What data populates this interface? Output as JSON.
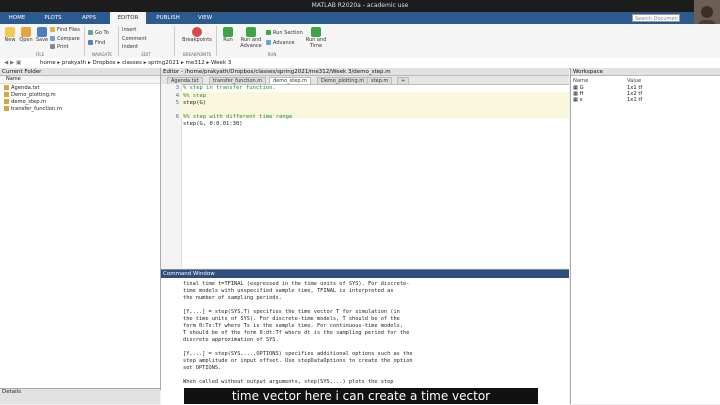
{
  "window_title": "MATLAB R2020a - academic use",
  "ribbon_tabs": [
    "HOME",
    "PLOTS",
    "APPS",
    "EDITOR",
    "PUBLISH",
    "VIEW"
  ],
  "search_placeholder": "Search Documen",
  "toolstrip": {
    "new": "New",
    "open": "Open",
    "save": "Save",
    "find_files": "Find Files",
    "compare": "Compare",
    "print": "Print",
    "go_to": "Go To",
    "find": "Find",
    "insert": "Insert",
    "comment": "Comment",
    "indent": "Indent",
    "breakpoints": "Breakpoints",
    "run": "Run",
    "run_and_advance": "Run and Advance",
    "run_section": "Run Section",
    "advance": "Advance",
    "run_and_time": "Run and Time",
    "groups": [
      "FILE",
      "NAVIGATE",
      "EDIT",
      "BREAKPOINTS",
      "RUN"
    ]
  },
  "address_path": [
    "home",
    "prakyath",
    "Dropbox",
    "classes",
    "spring2021",
    "me312",
    "Week 3"
  ],
  "current_folder": {
    "title": "Current Folder",
    "col_name": "Name",
    "files": [
      "Agenda.txt",
      "Demo_plotting.m",
      "demo_step.m",
      "transfer_function.m"
    ]
  },
  "details_label": "Details",
  "editor": {
    "title": "Editor - /home/prakyath/Dropbox/classes/spring2021/me312/Week 3/demo_step.m",
    "tabs": [
      "Agenda.txt",
      "transfer_function.m",
      "demo_step.m",
      "Demo_plotting.m",
      "step.m",
      "+"
    ],
    "active_tab_index": 2,
    "lines": [
      {
        "num": "3",
        "text": "% step in transfer function.",
        "comment": true
      },
      {
        "num": "4",
        "text": "%% step",
        "comment": true
      },
      {
        "num": "5",
        "text": "step(G)",
        "comment": false
      },
      {
        "num": "",
        "text": "",
        "comment": false
      },
      {
        "num": "6",
        "text": "%% step with different time range",
        "comment": true
      },
      {
        "num": "",
        "text": "step(G, 0:0.01:30)",
        "comment": false
      }
    ]
  },
  "command_window": {
    "title": "Command Window",
    "lines": [
      "final time t=TFINAL (expressed in the time units of SYS). For discrete-",
      "time models with unspecified sample time, TFINAL is interpreted as",
      "the number of sampling periods.",
      "",
      "[Y,...] = step(SYS,T) specifies the time vector T for simulation (in",
      "the time units of SYS). For discrete-time models, T should be of the",
      "form 0:Ts:Tf where Ts is the sample time. For continuous-time models,",
      "T should be of the form 0:dt:Tf where dt is the sampling period for the",
      "discrete approximation of SYS.",
      "",
      "[Y,...] = step(SYS,...,OPTIONS) specifies additional options such as the",
      "step amplitude or input offset. Use stepDataOptions to create the option",
      "set OPTIONS.",
      "",
      "When called without output arguments, step(SYS,...) plots the step"
    ]
  },
  "workspace": {
    "title": "Workspace",
    "col_name": "Name",
    "col_value": "Value",
    "vars": [
      {
        "name": "G",
        "value": "1x1 tf"
      },
      {
        "name": "H",
        "value": "1x2 tf"
      },
      {
        "name": "s",
        "value": "1x1 tf"
      }
    ]
  },
  "caption": "time vector here i can create a time vector"
}
